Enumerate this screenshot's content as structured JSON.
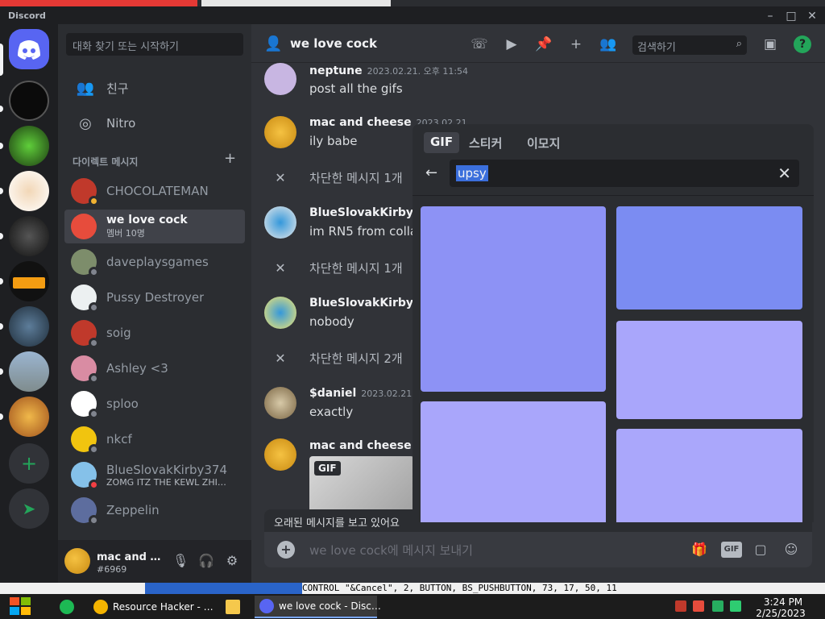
{
  "app": {
    "title": "Discord"
  },
  "servers": [
    {
      "name": "home",
      "color": "#5865f2"
    },
    {
      "name": "server-1",
      "color": "#0b0b0b"
    },
    {
      "name": "server-2",
      "color": "#1d3b12"
    },
    {
      "name": "server-3",
      "color": "#f2d7b7"
    },
    {
      "name": "server-4",
      "color": "#202020"
    },
    {
      "name": "server-5",
      "color": "#f39c12"
    },
    {
      "name": "server-6",
      "color": "#2c3e50"
    },
    {
      "name": "server-7",
      "color": "#7f8c8d"
    },
    {
      "name": "server-8",
      "color": "#d68910"
    }
  ],
  "sidebar": {
    "search_placeholder": "대화 찾기 또는 시작하기",
    "friends_label": "친구",
    "nitro_label": "Nitro",
    "dm_header": "다이렉트 메시지",
    "dms": [
      {
        "name": "CHOCOLATEMAN",
        "status": "idle",
        "color": "#c0392b"
      },
      {
        "name": "we love cock",
        "sub": "멤버 10명",
        "active": true,
        "color": "#e74c3c"
      },
      {
        "name": "daveplaysgames",
        "status": "offline",
        "color": "#7d8d6b"
      },
      {
        "name": "Pussy Destroyer",
        "status": "offline",
        "color": "#ecf0f1"
      },
      {
        "name": "soig",
        "status": "offline",
        "color": "#c0392b"
      },
      {
        "name": "Ashley <3",
        "status": "offline",
        "color": "#d98ca3"
      },
      {
        "name": "sploo",
        "status": "offline",
        "color": "#ffffff"
      },
      {
        "name": "nkcf",
        "status": "offline",
        "color": "#f1c40f"
      },
      {
        "name": "BlueSlovakKirby374",
        "sub": "ZOMG ITZ THE KEWL ZHIE…",
        "status": "dnd",
        "color": "#85c1e9"
      },
      {
        "name": "Zeppelin",
        "status": "offline",
        "color": "#5d6d9e"
      }
    ]
  },
  "user": {
    "name": "mac and c…",
    "tag": "#6969"
  },
  "chat": {
    "channel_name": "we love cock",
    "search_placeholder": "검색하기",
    "messages": [
      {
        "author": "neptune",
        "time": "2023.02.21. 오후 11:54",
        "text": "post all the gifs",
        "color": "#c8b6e2"
      },
      {
        "author": "mac and cheese",
        "time": "2023.02.21.",
        "text": "ily babe",
        "color": "#f5c242"
      },
      {
        "blocked": "차단한 메시지 1개"
      },
      {
        "author": "BlueSlovakKirby37",
        "time": "",
        "text": "im RN5 from collab",
        "color": "#85c1e9"
      },
      {
        "blocked": "차단한 메시지 1개"
      },
      {
        "author": "BlueSlovakKirby37",
        "time": "",
        "text": "nobody",
        "color": "#85c1e9"
      },
      {
        "blocked": "차단한 메시지 2개"
      },
      {
        "author": "$daniel",
        "time": "2023.02.21.",
        "text": "exactly",
        "color": "#d7c9a8"
      },
      {
        "author": "mac and cheese",
        "time": "2",
        "text": "",
        "color": "#f5c242"
      }
    ],
    "gif_badge": "GIF",
    "older_notice": "오래된 메시지를 보고 있어요",
    "composer_placeholder": "we love cock에 메시지 보내기",
    "gif_button": "GIF"
  },
  "picker": {
    "tabs": [
      "GIF",
      "스티커",
      "이모지"
    ],
    "search_value": "upsy",
    "tiles": [
      {
        "color": "#8d92f5"
      },
      {
        "color": "#7b8cf2"
      },
      {
        "color": "#a9a6fb"
      },
      {
        "color": "#a9a6fb"
      },
      {
        "color": "#aaa7fb"
      }
    ]
  },
  "taskbar": {
    "strip_text": "CONTROL \"&Cancel\", 2, BUTTON, BS_PUSHBUTTON, 73, 17, 50, 11",
    "apps": [
      {
        "label": "Resource Hacker - …"
      },
      {
        "label": "we love cock - Disc…"
      }
    ],
    "time": "3:24 PM",
    "date": "2/25/2023"
  }
}
